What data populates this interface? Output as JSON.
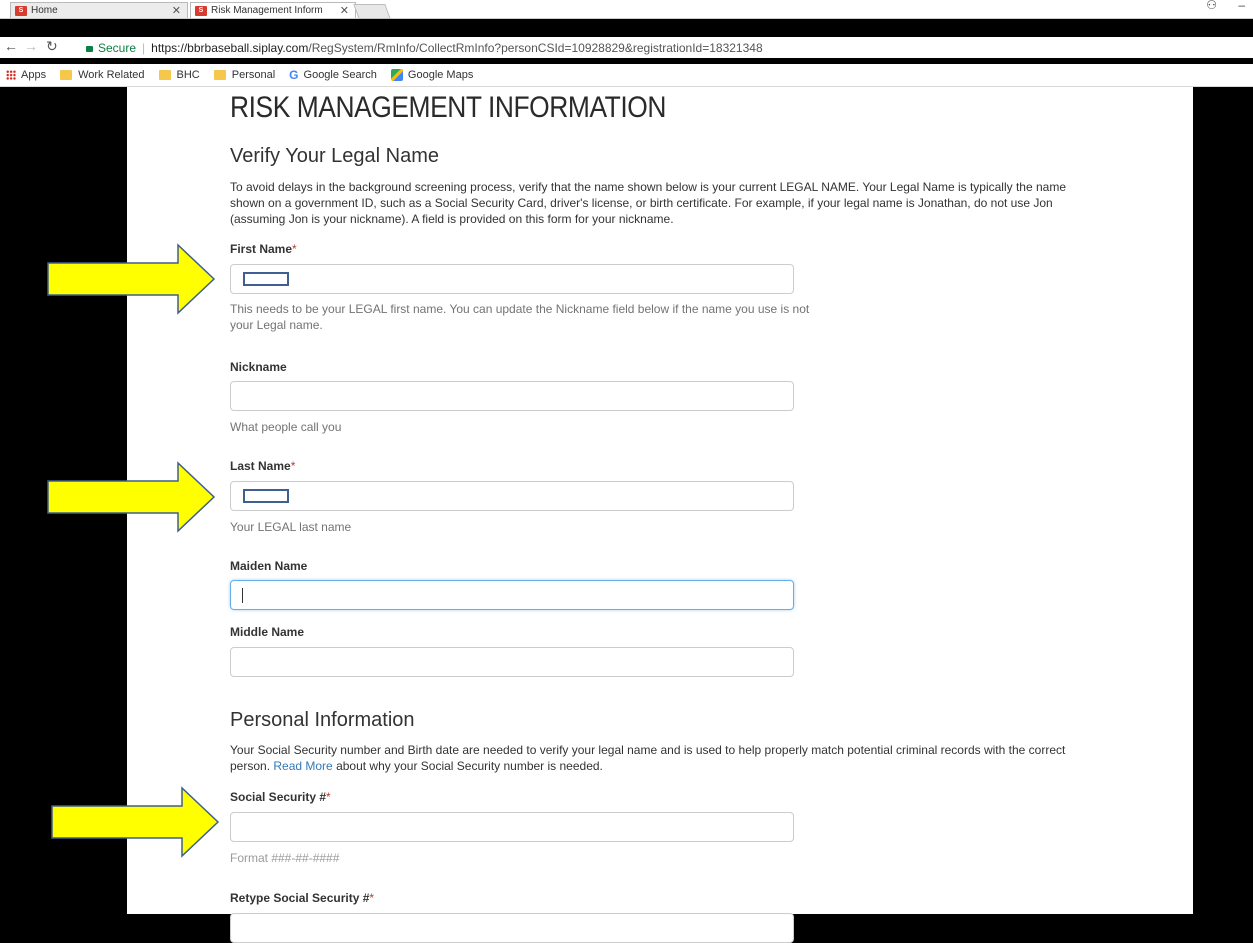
{
  "browser": {
    "tabs": [
      {
        "label": "Home",
        "active": false
      },
      {
        "label": "Risk Management Inform",
        "active": true
      }
    ],
    "omnibox": {
      "secure_label": "Secure",
      "url_host": "https://bbrbaseball.siplay.com",
      "url_path": "/RegSystem/RmInfo/CollectRmInfo?personCSId=10928829&registrationId=18321348"
    },
    "bookmarks": [
      "Apps",
      "Work Related",
      "BHC",
      "Personal",
      "Google Search",
      "Google Maps"
    ],
    "accent_secure": "#0b8043"
  },
  "page": {
    "title": "RISK MANAGEMENT INFORMATION",
    "legal_section": {
      "heading": "Verify Your Legal Name",
      "intro": "To avoid delays in the background screening process, verify that the name shown below is your current LEGAL NAME. Your Legal Name is typically the name shown on a government ID, such as a Social Security Card, driver's license, or birth certificate. For example, if your legal name is Jonathan, do not use Jon (assuming Jon is your nickname). A field is provided on this form for your nickname.",
      "first_name": {
        "label": "First Name",
        "required_mark": "*",
        "help": "This needs to be your LEGAL first name. You can update the Nickname field below if the name you use is not your Legal name."
      },
      "nickname": {
        "label": "Nickname",
        "help": "What people call you"
      },
      "last_name": {
        "label": "Last Name",
        "required_mark": "*",
        "help": "Your LEGAL last name"
      },
      "maiden_name": {
        "label": "Maiden Name"
      },
      "middle_name": {
        "label": "Middle Name"
      }
    },
    "personal_section": {
      "heading": "Personal Information",
      "intro_before_link": "Your Social Security number and Birth date are needed to verify your legal name and is used to help properly match potential criminal records with the correct person. ",
      "read_more": "Read More",
      "intro_after_link": " about why your Social Security number is needed.",
      "ssn": {
        "label": "Social Security #",
        "required_mark": "*",
        "help": "Format ###-##-####"
      },
      "ssn_retype": {
        "label": "Retype Social Security #",
        "required_mark": "*"
      }
    }
  },
  "annotation_arrow_color": "#ffff00"
}
